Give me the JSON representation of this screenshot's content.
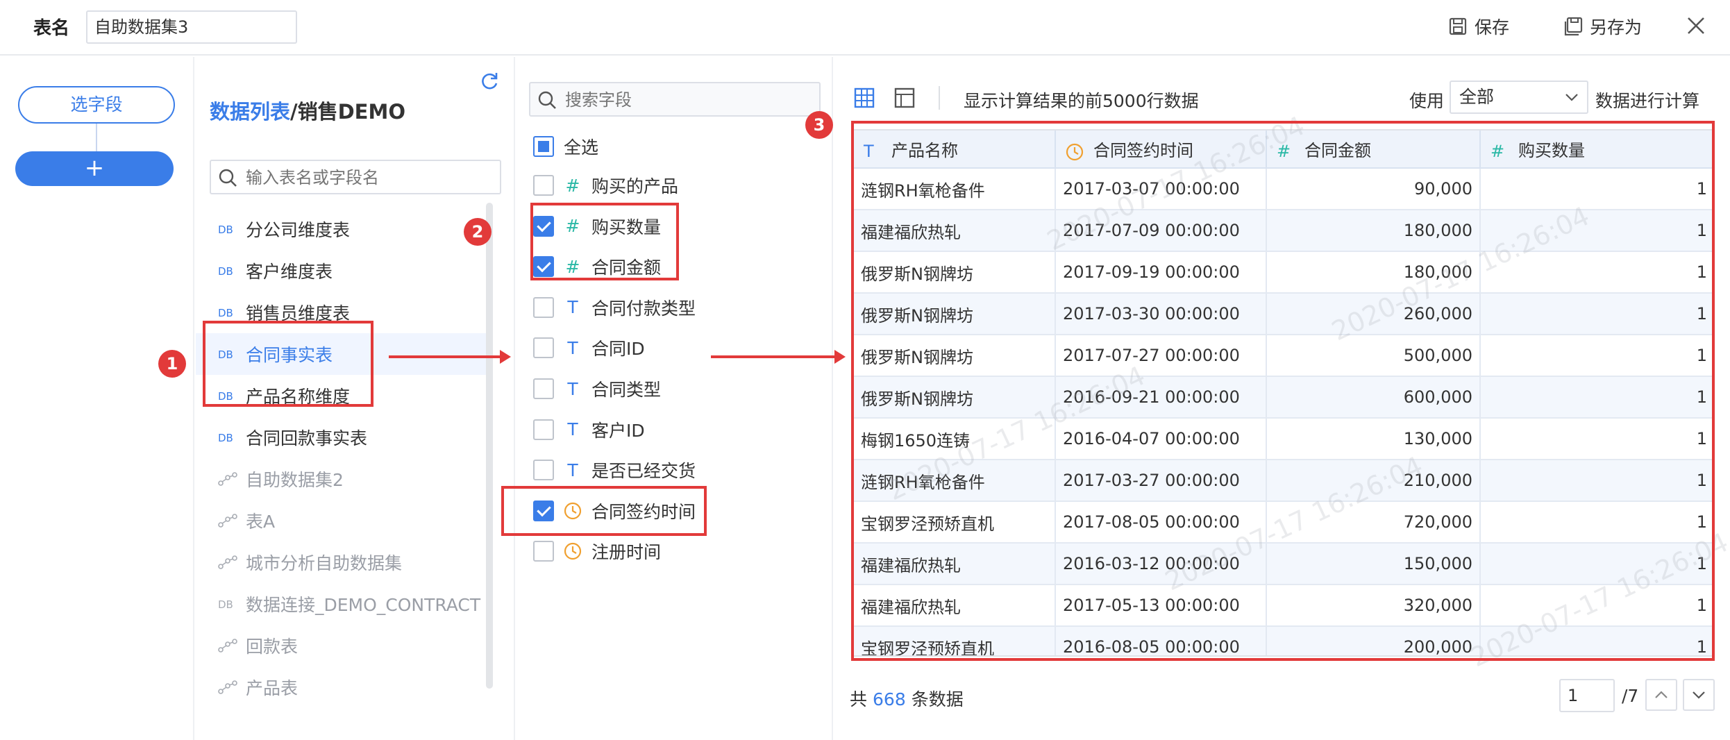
{
  "header": {
    "table_name_label": "表名",
    "table_name_value": "自助数据集3",
    "save_label": "保存",
    "save_as_label": "另存为"
  },
  "left_panel": {
    "select_field_label": "选字段",
    "add_label": "+"
  },
  "datasource": {
    "title_part1": "数据列表",
    "title_sep": "/",
    "title_part2": "销售DEMO",
    "search_placeholder": "输入表名或字段名",
    "items": [
      {
        "label": "分公司维度表",
        "icon": "db-table-icon",
        "state": "normal"
      },
      {
        "label": "客户维度表",
        "icon": "db-table-icon",
        "state": "normal"
      },
      {
        "label": "销售员维度表",
        "icon": "db-table-icon",
        "state": "normal"
      },
      {
        "label": "合同事实表",
        "icon": "db-table-icon",
        "state": "active"
      },
      {
        "label": "产品名称维度",
        "icon": "db-table-icon",
        "state": "normal"
      },
      {
        "label": "合同回款事实表",
        "icon": "db-table-icon",
        "state": "normal"
      },
      {
        "label": "自助数据集2",
        "icon": "self-service-dataset-icon",
        "state": "dim"
      },
      {
        "label": "表A",
        "icon": "self-service-dataset-icon",
        "state": "dim"
      },
      {
        "label": "城市分析自助数据集",
        "icon": "self-service-dataset-icon",
        "state": "dim"
      },
      {
        "label": "数据连接_DEMO_CONTRACT",
        "icon": "db-table-icon",
        "state": "dim"
      },
      {
        "label": "回款表",
        "icon": "self-service-dataset-icon",
        "state": "dim"
      },
      {
        "label": "产品表",
        "icon": "self-service-dataset-icon",
        "state": "dim"
      }
    ]
  },
  "fields": {
    "search_placeholder": "搜索字段",
    "select_all_label": "全选",
    "items": [
      {
        "label": "购买的产品",
        "type": "number",
        "checked": false
      },
      {
        "label": "购买数量",
        "type": "number",
        "checked": true
      },
      {
        "label": "合同金额",
        "type": "number",
        "checked": true
      },
      {
        "label": "合同付款类型",
        "type": "text",
        "checked": false
      },
      {
        "label": "合同ID",
        "type": "text",
        "checked": false
      },
      {
        "label": "合同类型",
        "type": "text",
        "checked": false
      },
      {
        "label": "客户ID",
        "type": "text",
        "checked": false
      },
      {
        "label": "是否已经交货",
        "type": "text",
        "checked": false
      },
      {
        "label": "合同签约时间",
        "type": "date",
        "checked": true
      },
      {
        "label": "注册时间",
        "type": "date",
        "checked": false
      }
    ]
  },
  "preview": {
    "info_text": "显示计算结果的前5000行数据",
    "use_label": "使用",
    "use_select_value": "全部",
    "calc_label": "数据进行计算",
    "columns": [
      {
        "label": "产品名称",
        "type": "text"
      },
      {
        "label": "合同签约时间",
        "type": "date"
      },
      {
        "label": "合同金额",
        "type": "number"
      },
      {
        "label": "购买数量",
        "type": "number"
      }
    ],
    "rows": [
      [
        "涟钢RH氧枪备件",
        "2017-03-07 00:00:00",
        "90,000",
        "1"
      ],
      [
        "福建福欣热轧",
        "2017-07-09 00:00:00",
        "180,000",
        "1"
      ],
      [
        "俄罗斯N钢牌坊",
        "2017-09-19 00:00:00",
        "180,000",
        "1"
      ],
      [
        "俄罗斯N钢牌坊",
        "2017-03-30 00:00:00",
        "260,000",
        "1"
      ],
      [
        "俄罗斯N钢牌坊",
        "2017-07-27 00:00:00",
        "500,000",
        "1"
      ],
      [
        "俄罗斯N钢牌坊",
        "2016-09-21 00:00:00",
        "600,000",
        "1"
      ],
      [
        "梅钢1650连铸",
        "2016-04-07 00:00:00",
        "130,000",
        "1"
      ],
      [
        "涟钢RH氧枪备件",
        "2017-03-27 00:00:00",
        "210,000",
        "1"
      ],
      [
        "宝钢罗泾预矫直机",
        "2017-08-05 00:00:00",
        "720,000",
        "1"
      ],
      [
        "福建福欣热轧",
        "2016-03-12 00:00:00",
        "150,000",
        "1"
      ],
      [
        "福建福欣热轧",
        "2017-05-13 00:00:00",
        "320,000",
        "1"
      ],
      [
        "宝钢罗泾预矫直机",
        "2016-08-05 00:00:00",
        "200,000",
        "1"
      ]
    ],
    "watermark_text": "2020-07-17 16:26:04",
    "footer_prefix": "共",
    "footer_count": "668",
    "footer_suffix": "条数据",
    "page_current": "1",
    "page_total": "/7"
  },
  "annotations": {
    "badge_1": "1",
    "badge_2": "2",
    "badge_3": "3",
    "color": "#e23a3a"
  },
  "colors": {
    "accent": "#3a7de8",
    "number_type": "#2bb8a6",
    "date_type": "#f0a030"
  }
}
